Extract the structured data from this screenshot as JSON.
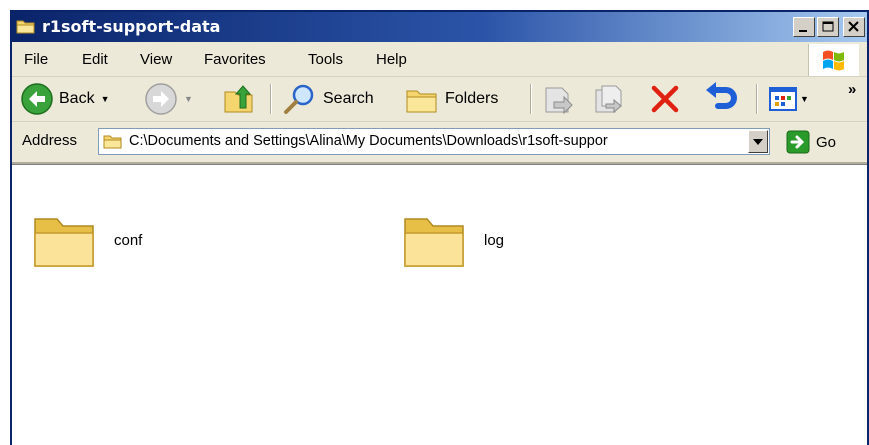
{
  "window": {
    "title": "r1soft-support-data"
  },
  "menu": {
    "items": [
      "File",
      "Edit",
      "View",
      "Favorites",
      "Tools",
      "Help"
    ]
  },
  "toolbar": {
    "back_label": "Back",
    "search_label": "Search",
    "folders_label": "Folders",
    "more_label": "»"
  },
  "address": {
    "label": "Address",
    "value": "C:\\Documents and Settings\\Alina\\My Documents\\Downloads\\r1soft-suppor",
    "go_label": "Go"
  },
  "content": {
    "items": [
      {
        "label": "conf",
        "icon": "folder-icon"
      },
      {
        "label": "log",
        "icon": "folder-icon"
      }
    ]
  },
  "colors": {
    "title_bar_start": "#0a246a",
    "title_bar_end": "#a6caf0",
    "chrome": "#ece9d8",
    "folder": "#f5d66e",
    "delete_red": "#e02010",
    "undo_blue": "#1e5fd8",
    "go_green": "#2a9a2a"
  }
}
